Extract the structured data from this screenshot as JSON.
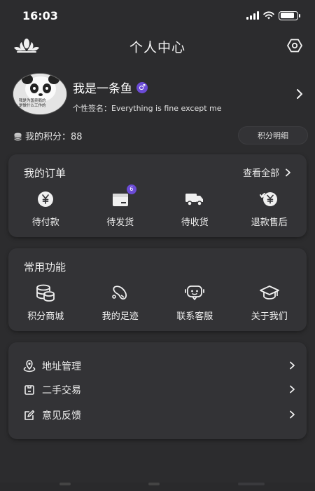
{
  "status_bar": {
    "time": "16:03"
  },
  "nav": {
    "title": "个人中心"
  },
  "profile": {
    "username": "我是一条鱼",
    "gender": "♂",
    "signature_label": "个性签名：",
    "signature": "Everything is fine except me",
    "avatar_caption_1": "我是为国卖鹅的",
    "avatar_caption_2": "是做什么工作的"
  },
  "points": {
    "label": "我的积分：",
    "value": "88",
    "detail_button": "积分明细"
  },
  "orders": {
    "title": "我的订单",
    "view_all": "查看全部",
    "items": [
      {
        "label": "待付款",
        "icon": "yen-circle-icon"
      },
      {
        "label": "待发货",
        "icon": "package-icon",
        "badge": "6"
      },
      {
        "label": "待收货",
        "icon": "truck-icon"
      },
      {
        "label": "退款售后",
        "icon": "refund-icon"
      }
    ]
  },
  "common": {
    "title": "常用功能",
    "items": [
      {
        "label": "积分商城",
        "icon": "coins-stack-icon"
      },
      {
        "label": "我的足迹",
        "icon": "footprint-icon"
      },
      {
        "label": "联系客服",
        "icon": "customer-service-icon"
      },
      {
        "label": "关于我们",
        "icon": "graduation-cap-icon"
      }
    ]
  },
  "menu": {
    "items": [
      {
        "label": "地址管理",
        "icon": "location-icon"
      },
      {
        "label": "二手交易",
        "icon": "trade-icon"
      },
      {
        "label": "意见反馈",
        "icon": "feedback-icon"
      }
    ]
  },
  "colors": {
    "background": "#2c2c2e",
    "card": "#333336",
    "accent": "#6b4bd6"
  }
}
